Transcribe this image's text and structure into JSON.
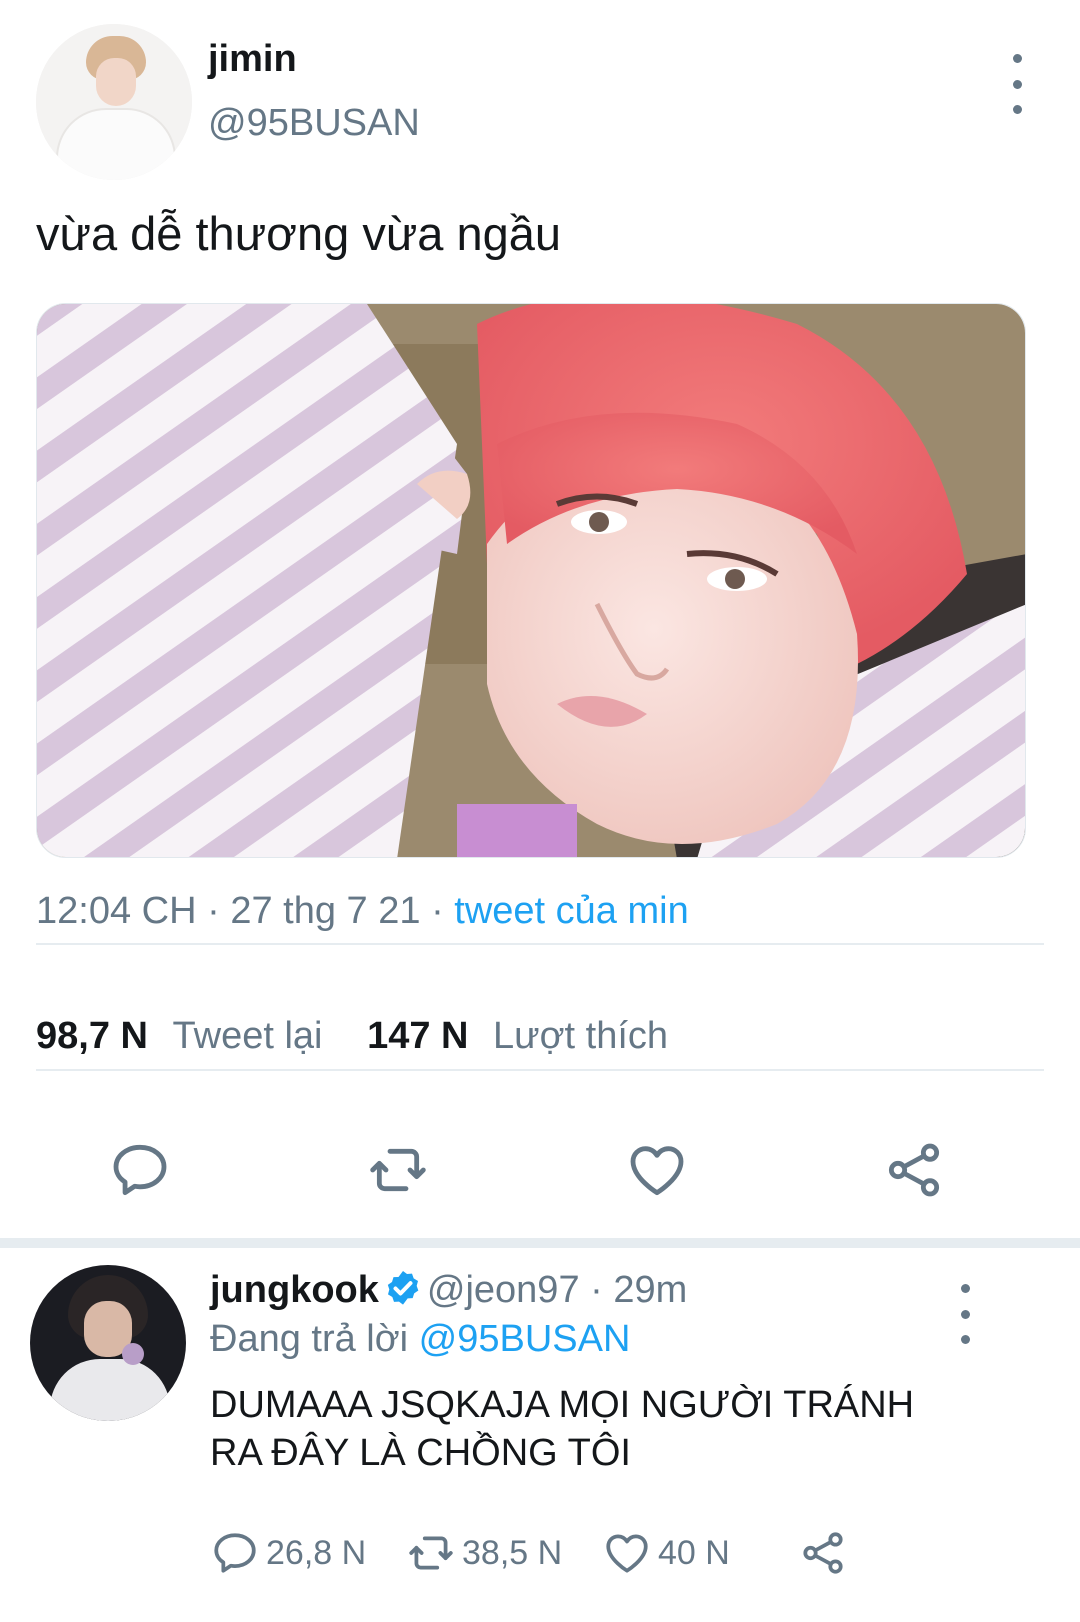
{
  "tweet": {
    "author_name": "jimin",
    "author_handle": "@95BUSAN",
    "text": "vừa dễ thương vừa ngầu",
    "time": "12:04 CH",
    "date": "27 thg 7 21",
    "source": "tweet của min",
    "retweets_count": "98,7 N",
    "retweets_label": "Tweet lại",
    "likes_count": "147 N",
    "likes_label": "Lượt thích"
  },
  "reply": {
    "author_name": "jungkook",
    "author_handle": "@jeon97",
    "time": "29m",
    "replying_prefix": "Đang trả lời",
    "replying_to": "@95BUSAN",
    "text_line1": "DUMAAA JSQKAJA MỌI NGƯỜI TRÁNH",
    "text_line2": "RA ĐÂY LÀ CHỒNG TÔI",
    "replies": "26,8 N",
    "retweets": "38,5 N",
    "likes": "40 N"
  },
  "icons": {
    "reply": "speech-bubble-icon",
    "retweet": "retweet-arrows-icon",
    "like": "heart-icon",
    "share": "share-icon",
    "more": "vertical-dots-icon",
    "verified": "verified-badge-icon"
  },
  "colors": {
    "text": "#14171a",
    "secondary": "#657786",
    "link": "#1da1f2",
    "divider": "#e6ecf0",
    "verified": "#1da1f2"
  }
}
